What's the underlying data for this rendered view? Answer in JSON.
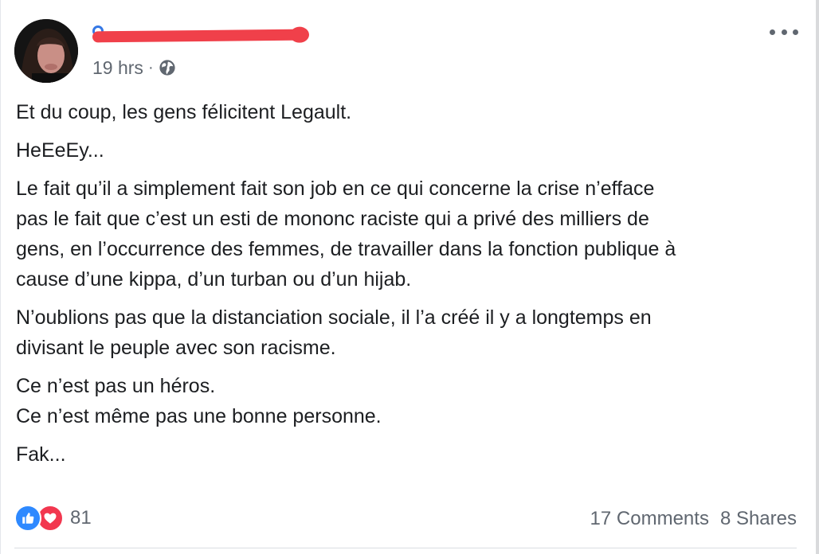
{
  "post": {
    "timestamp": "19 hrs",
    "separator": "·",
    "audience_icon": "globe-icon",
    "paragraphs": [
      {
        "lines": [
          "Et du coup, les gens félicitent Legault."
        ]
      },
      {
        "lines": [
          "HeEeEy..."
        ]
      },
      {
        "lines": [
          "Le fait qu’il a simplement fait son job en ce qui concerne la crise n’efface",
          "pas le fait que c’est un esti de mononc raciste qui a privé des milliers de",
          "gens, en l’occurrence des femmes, de travailler dans la fonction publique à",
          "cause d’une kippa, d’un turban ou d’un hijab."
        ]
      },
      {
        "lines": [
          "N’oublions pas que la distanciation sociale, il l’a créé il y a longtemps en",
          "divisant le peuple avec son racisme."
        ]
      },
      {
        "lines": [
          "Ce n’est pas un héros.",
          "Ce n’est même pas une bonne personne."
        ]
      },
      {
        "lines": [
          "Fak..."
        ]
      }
    ]
  },
  "footer": {
    "reaction_icons": [
      "like-icon",
      "love-icon"
    ],
    "reaction_count": "81",
    "comments": "17 Comments",
    "shares": "8 Shares"
  },
  "colors": {
    "redaction": "#f0404a",
    "like": "#2e89ff",
    "love": "#f2374f",
    "secondary_text": "#606770"
  }
}
